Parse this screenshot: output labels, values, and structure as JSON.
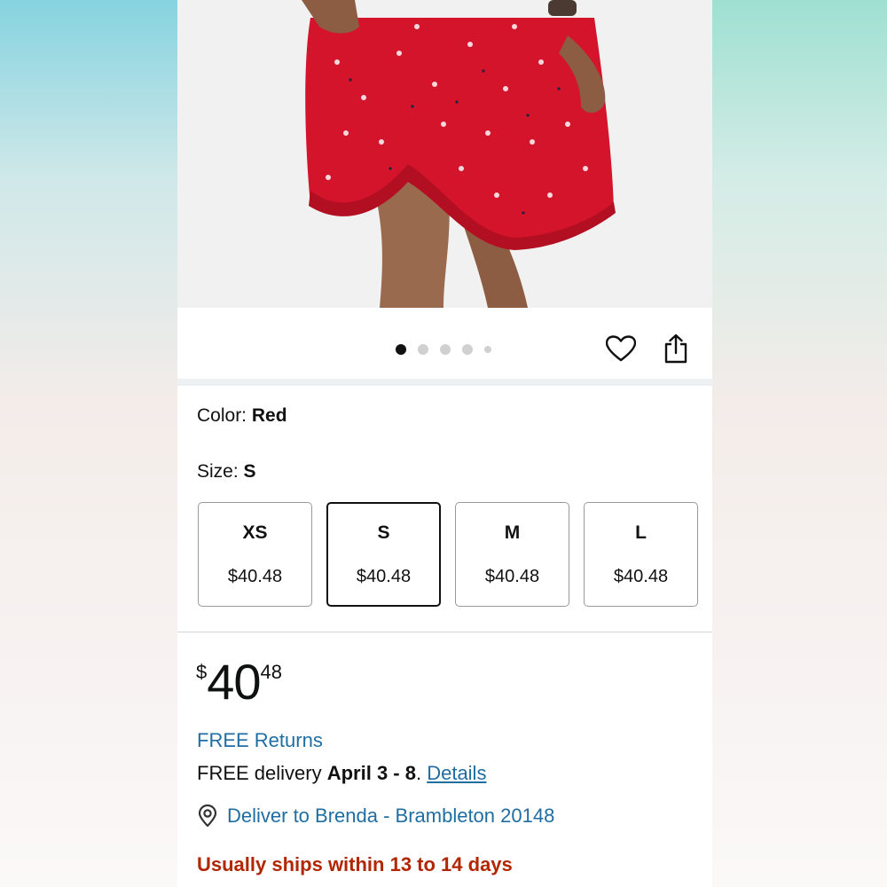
{
  "product": {
    "image_dots_active": 1,
    "image_dots_count": 5
  },
  "options": {
    "color_label": "Color: ",
    "color_value": "Red",
    "size_label": "Size: ",
    "size_value": "S",
    "sizes": [
      {
        "name": "XS",
        "price": "$40.48"
      },
      {
        "name": "S",
        "price": "$40.48"
      },
      {
        "name": "M",
        "price": "$40.48"
      },
      {
        "name": "L",
        "price": "$40.48"
      }
    ]
  },
  "buy": {
    "price_symbol": "$",
    "price_whole": "40",
    "price_fraction": "48",
    "free_returns": "FREE Returns",
    "delivery_prefix": "FREE delivery ",
    "delivery_date": "April 3 - 8",
    "delivery_punct": ". ",
    "details_link": "Details",
    "deliver_to": "Deliver to Brenda - Brambleton 20148",
    "ships_note": "Usually ships within 13 to 14 days"
  },
  "colors": {
    "link": "#1f6ea3",
    "ships_note": "#b12704",
    "selected_border": "#111111"
  },
  "icons": {
    "wishlist": "heart-icon",
    "share": "share-icon",
    "location": "location-pin-icon"
  }
}
